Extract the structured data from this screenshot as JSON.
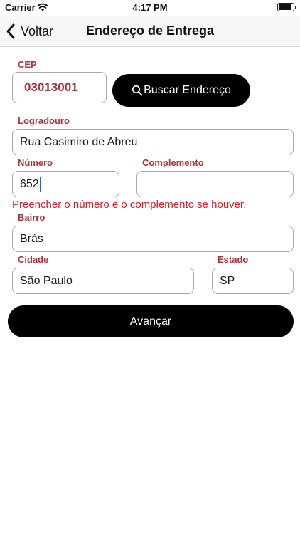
{
  "status_bar": {
    "carrier": "Carrier",
    "time": "4:17 PM",
    "battery_level": 0.95
  },
  "nav": {
    "back_label": "Voltar",
    "title": "Endereço de Entrega"
  },
  "form": {
    "cep": {
      "label": "CEP",
      "value": "03013001"
    },
    "search_button": {
      "label": "Buscar Endereço",
      "icon": "search-icon"
    },
    "logradouro": {
      "label": "Logradouro",
      "value": "Rua Casimiro de Abreu"
    },
    "numero": {
      "label": "Número",
      "value": "652"
    },
    "complemento": {
      "label": "Complemento",
      "value": ""
    },
    "hint": "Preencher o número e o complemento se houver.",
    "bairro": {
      "label": "Bairro",
      "value": "Brás"
    },
    "cidade": {
      "label": "Cidade",
      "value": "São Paulo"
    },
    "estado": {
      "label": "Estado",
      "value": "SP"
    }
  },
  "actions": {
    "next_label": "Avançar"
  },
  "colors": {
    "label": "#a3373d",
    "hint": "#d32020",
    "button_bg": "#000000",
    "cursor": "#1f63d6"
  }
}
